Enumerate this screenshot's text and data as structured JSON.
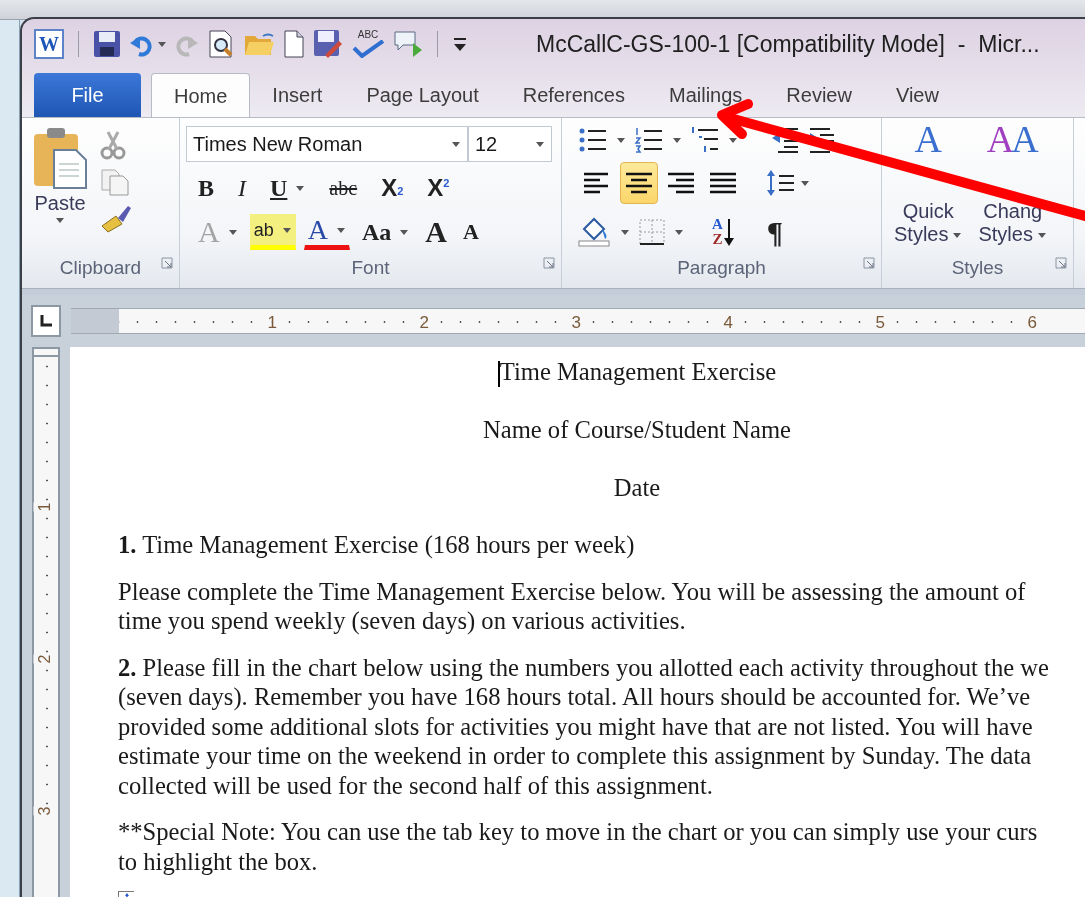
{
  "quick_access": {
    "logo": "W",
    "spelling_label": "ABC"
  },
  "window": {
    "title": "McCallC-GS-100-1 [Compatibility Mode]  -  Micr..."
  },
  "tabs": [
    {
      "label": "File",
      "kind": "file",
      "selected": false
    },
    {
      "label": "Home",
      "kind": "tab",
      "selected": true
    },
    {
      "label": "Insert",
      "kind": "tab",
      "selected": false
    },
    {
      "label": "Page Layout",
      "kind": "tab",
      "selected": false
    },
    {
      "label": "References",
      "kind": "tab",
      "selected": false
    },
    {
      "label": "Mailings",
      "kind": "tab",
      "selected": false
    },
    {
      "label": "Review",
      "kind": "tab",
      "selected": false
    },
    {
      "label": "View",
      "kind": "tab",
      "selected": false
    }
  ],
  "ribbon": {
    "clipboard": {
      "label": "Clipboard",
      "paste": "Paste"
    },
    "font": {
      "label": "Font",
      "font_name": "Times New Roman",
      "font_size": "12",
      "row1": [
        {
          "glyph": "B",
          "kind": "bold",
          "menu": false
        },
        {
          "glyph": "I",
          "kind": "italic",
          "menu": false
        },
        {
          "glyph": "U",
          "kind": "underline",
          "menu": true
        },
        {
          "glyph": "abc",
          "kind": "strike",
          "menu": false
        },
        {
          "glyph": "X",
          "sub": "2",
          "kind": "subscript",
          "menu": false
        },
        {
          "glyph": "X",
          "sup": "2",
          "kind": "superscript",
          "menu": false
        }
      ],
      "row2": [
        {
          "glyph": "A",
          "kind": "effects",
          "menu": true,
          "disabled": true
        },
        {
          "glyph": "ab",
          "kind": "highlight",
          "menu": true,
          "disabled": false
        },
        {
          "glyph": "A",
          "kind": "color",
          "menu": true,
          "disabled": false
        },
        {
          "glyph": "Aa",
          "kind": "case",
          "menu": true,
          "disabled": false
        },
        {
          "glyph": "A",
          "kind": "grow",
          "menu": false,
          "disabled": false
        },
        {
          "glyph": "A",
          "kind": "shrink",
          "menu": false,
          "disabled": false
        }
      ]
    },
    "paragraph": {
      "label": "Paragraph",
      "alignment": [
        {
          "kind": "left",
          "selected": false
        },
        {
          "kind": "center",
          "selected": true
        },
        {
          "kind": "right",
          "selected": false
        },
        {
          "kind": "justify",
          "selected": false
        }
      ],
      "sort": [
        "A",
        "Z"
      ],
      "pilcrow": "¶"
    },
    "styles": {
      "label": "Styles",
      "buttons": [
        {
          "glyphs": [
            "A"
          ],
          "line1": "Quick",
          "line2": "Styles"
        },
        {
          "glyphs": [
            "A",
            "A"
          ],
          "line1": "Chang",
          "line2": "Styles"
        }
      ]
    }
  },
  "ruler": {
    "numbers": [
      "1",
      "2",
      "3",
      "4",
      "5",
      "6"
    ]
  },
  "vertical_ruler": {
    "numbers": [
      "1",
      "2",
      "3"
    ]
  },
  "document": {
    "paragraphs": [
      {
        "kind": "center",
        "cursor": true,
        "lines": [
          "Time Management Exercise"
        ]
      },
      {
        "kind": "center",
        "cursor": false,
        "lines": [
          "Name of Course/Student Name"
        ]
      },
      {
        "kind": "center",
        "cursor": false,
        "lines": [
          "Date"
        ]
      },
      {
        "kind": "body",
        "cursor": false,
        "lines": [
          "**1.** Time Management Exercise (168 hours per week)"
        ]
      },
      {
        "kind": "body",
        "cursor": false,
        "lines": [
          "Please complete the Time Management Exercise below. You will  be assessing the amount of",
          "time you spend weekly (seven days) on various activities."
        ]
      },
      {
        "kind": "body",
        "cursor": false,
        "lines": [
          "**2.** Please fill in the chart below using the numbers you allotted each activity throughout the we",
          "(seven days). Remember you have 168 hours total. All hours should be accounted for. We’ve",
          "provided some additional slots for activities you might have that are not listed. You will  have",
          "estimate your time on the weekend in order to complete this assignment by Sunday. The data",
          "collected will  be used for the second half of this assignment."
        ]
      },
      {
        "kind": "body",
        "cursor": false,
        "lines": [
          "**Special Note: You can use the tab key to move in the chart or you can simply use your curs",
          "to highlight the box."
        ]
      }
    ]
  }
}
